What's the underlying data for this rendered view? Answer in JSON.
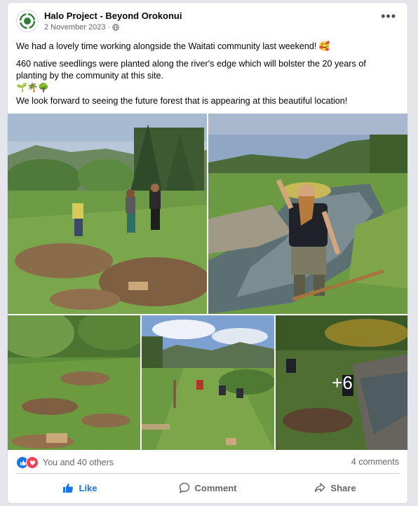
{
  "post": {
    "page_name": "Halo Project - Beyond Orokonui",
    "date": "2 November 2023",
    "audience_icon": "globe-icon",
    "options_icon": "more-options-icon",
    "text": {
      "line1": "We had a lovely time working alongside the Waitati community last weekend! 🥰",
      "line2": "460 native seedlings were planted along the river's edge which will bolster the 20 years of planting by the community at this site.",
      "line3": "🌱🌴🌳",
      "line4": "We look forward to seeing the future forest that is appearing at this beautiful location!"
    }
  },
  "photos": {
    "more_count": "+6"
  },
  "reactions": {
    "icons": [
      "like-reaction-icon",
      "love-reaction-icon"
    ],
    "summary": "You and 40 others",
    "comments": "4 comments"
  },
  "actions": {
    "like": "Like",
    "comment": "Comment",
    "share": "Share"
  },
  "colors": {
    "accent": "#1b74e4",
    "love": "#f33e58",
    "brand_green": "#2e7d32"
  }
}
